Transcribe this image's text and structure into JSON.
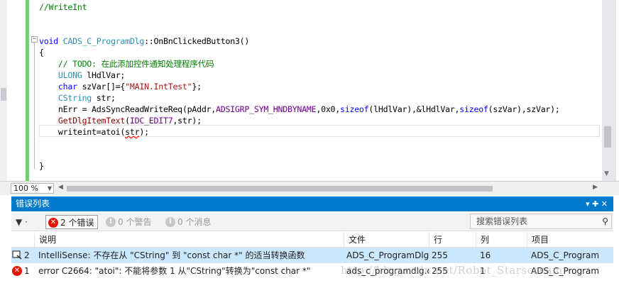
{
  "editor": {
    "lines": [
      {
        "parts": [
          {
            "c": "cm",
            "t": "//WriteInt"
          }
        ]
      },
      {
        "parts": [
          {
            "c": "kw",
            "t": "void "
          },
          {
            "c": "ty",
            "t": "CADS_C_ProgramDlg"
          },
          {
            "c": "tx",
            "t": "::OnBnClickedButton3()"
          }
        ]
      },
      {
        "parts": [
          {
            "c": "tx",
            "t": "{"
          }
        ]
      },
      {
        "parts": [
          {
            "c": "cm",
            "t": "    // TODO: 在此添加控件通知处理程序代码"
          }
        ]
      },
      {
        "parts": [
          {
            "c": "ty",
            "t": "    ULONG"
          },
          {
            "c": "tx",
            "t": " lHdlVar;"
          }
        ]
      },
      {
        "parts": [
          {
            "c": "kw",
            "t": "    char"
          },
          {
            "c": "tx",
            "t": " szVar[]={"
          },
          {
            "c": "st",
            "t": "\"MAIN.IntTest\""
          },
          {
            "c": "tx",
            "t": "};"
          }
        ]
      },
      {
        "parts": [
          {
            "c": "ty",
            "t": "    CString"
          },
          {
            "c": "tx",
            "t": " str;"
          }
        ]
      },
      {
        "parts": [
          {
            "c": "tx",
            "t": "    nErr = AdsSyncReadWriteReq(pAddr,"
          },
          {
            "c": "mc",
            "t": "ADSIGRP_SYM_HNDBYNAME"
          },
          {
            "c": "tx",
            "t": ",0x0,"
          },
          {
            "c": "kw",
            "t": "sizeof"
          },
          {
            "c": "tx",
            "t": "(lHdlVar),&lHdlVar,"
          },
          {
            "c": "kw",
            "t": "sizeof"
          },
          {
            "c": "tx",
            "t": "(szVar),szVar);"
          }
        ]
      },
      {
        "parts": [
          {
            "c": "fn",
            "t": "    GetDlgItemText"
          },
          {
            "c": "tx",
            "t": "("
          },
          {
            "c": "mc",
            "t": "IDC_EDIT7"
          },
          {
            "c": "tx",
            "t": ",str);"
          }
        ]
      },
      {
        "parts": [
          {
            "c": "tx",
            "t": "    writeint=atoi("
          },
          {
            "c": "tx squig",
            "t": "str"
          },
          {
            "c": "tx",
            "t": ");"
          }
        ]
      },
      {
        "parts": [
          {
            "c": "tx",
            "t": "}"
          }
        ]
      }
    ],
    "outline_toggle": "−",
    "zoom": "100 %"
  },
  "panel": {
    "title": "错误列表",
    "pin": "▾ ✚ ✕",
    "filter_label": "▼ ·",
    "errors_button": "2 个错误",
    "warnings_button": "0 个警告",
    "messages_button": "0 个消息",
    "search_placeholder": "搜索错误列表",
    "search_icon": "magnifier-icon"
  },
  "table": {
    "headers": [
      "说明",
      "文件",
      "行",
      "列",
      "项目"
    ],
    "rows": [
      {
        "num": "2",
        "desc": "IntelliSense: 不存在从 \"CString\" 到 \"const char *\" 的适当转换函数",
        "file": "ADS_C_ProgramDlg.cpp",
        "line": "255",
        "col": "16",
        "project": "ADS_C_Program"
      },
      {
        "num": "1",
        "desc": "error C2664: \"atoi\": 不能将参数 1 从\"CString\"转换为\"const char *\"",
        "file": "ads_c_programdlg.cpp",
        "line": "255",
        "col": "1",
        "project": "ADS_C_Program"
      }
    ]
  },
  "watermark": "http://blog.csdn.net/Robot_Starscream",
  "colors": {
    "accent": "#007acc",
    "selected_row": "#cce8ff",
    "error": "#e51400"
  }
}
